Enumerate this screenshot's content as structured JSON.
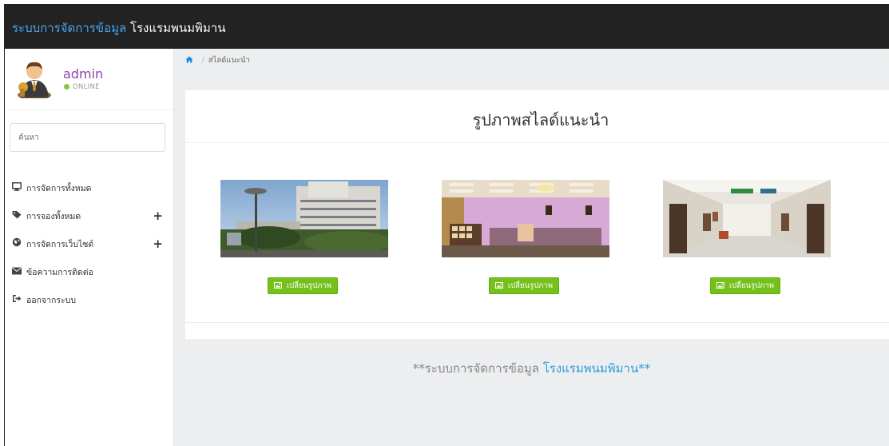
{
  "header": {
    "brand_part1": "ระบบการจัดการข้อมูล",
    "brand_part2": "โรงแรมพนมพิมาน"
  },
  "user": {
    "name": "admin",
    "status": "ONLINE",
    "status_color": "#8bc34a"
  },
  "search": {
    "placeholder": "ค้นหา"
  },
  "menu": [
    {
      "icon": "monitor-icon",
      "label": "การจัดการทั้งหมด",
      "expandable": false
    },
    {
      "icon": "tag-icon",
      "label": "การจองทั้งหมด",
      "expandable": true
    },
    {
      "icon": "globe-icon",
      "label": "การจัดการเว็บไซต์",
      "expandable": true
    },
    {
      "icon": "envelope-icon",
      "label": "ข้อความการติดต่อ",
      "expandable": false
    },
    {
      "icon": "sign-out-icon",
      "label": "ออกจากระบบ",
      "expandable": false
    }
  ],
  "menu_plus": "+",
  "breadcrumb": {
    "current": "สไลด์แนะนำ",
    "separator": "/"
  },
  "panel": {
    "title": "รูปภาพสไลด์แนะนำ",
    "change_label": "เปลี่ยนรูปภาพ",
    "slides": [
      {
        "image": "hotel-exterior-photo"
      },
      {
        "image": "hotel-lobby-photo"
      },
      {
        "image": "hotel-corridor-photo"
      }
    ]
  },
  "footer": {
    "prefix": "**ระบบการจัดการข้อมูล",
    "highlight": "โรงแรมพนมพิมาน**"
  },
  "colors": {
    "topbar": "#222222",
    "brand_accent": "#4aa3e8",
    "button_green": "#75c11b",
    "footer_highlight": "#2e9cdb",
    "username": "#8e44ad"
  }
}
